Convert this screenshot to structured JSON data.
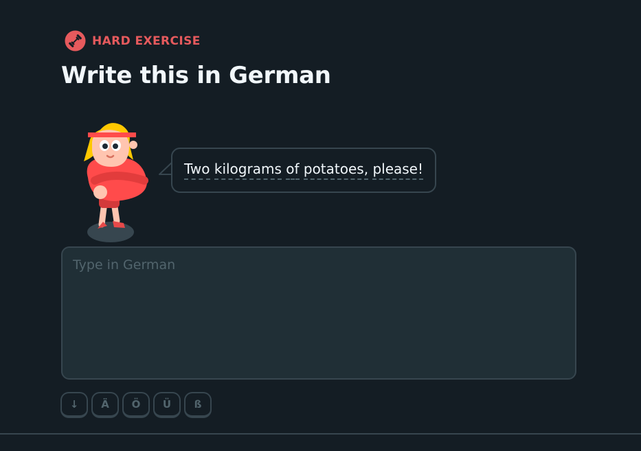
{
  "header": {
    "badge_icon": "dumbbell-icon",
    "badge_label": "HARD EXERCISE",
    "badge_color": "#e65a5d",
    "title": "Write this in German"
  },
  "prompt": {
    "words": [
      "Two",
      "kilograms",
      "of",
      "potatoes,",
      "please!"
    ]
  },
  "answer": {
    "placeholder": "Type in German",
    "value": ""
  },
  "special_keys": [
    "↓",
    "Ä",
    "Ö",
    "Ü",
    "ß"
  ],
  "colors": {
    "background": "#141d24",
    "border": "#37464f",
    "field": "#202f36",
    "muted_text": "#52656d",
    "accent_red": "#e65a5d"
  }
}
